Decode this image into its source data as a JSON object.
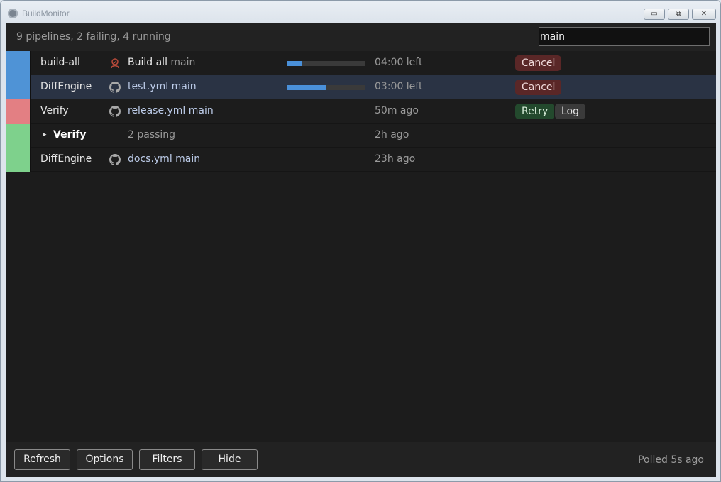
{
  "window": {
    "title": "BuildMonitor",
    "controls": {
      "minimize": "▭",
      "maximize": "⧉",
      "close": "✕"
    }
  },
  "summary": "9 pipelines, 2 failing, 4 running",
  "search": {
    "value": "main"
  },
  "colors": {
    "running": "#4f93d6",
    "failed": "#e37f83",
    "passed": "#7ed18c"
  },
  "rows": [
    {
      "status": "running",
      "name": "build-all",
      "icon": "person-icon",
      "workflow": "Build all",
      "branch": "main",
      "progress": 0.2,
      "time": "04:00 left",
      "actions": [
        "Cancel"
      ]
    },
    {
      "status": "running",
      "name": "DiffEngine",
      "icon": "github-icon",
      "workflow": "test.yml",
      "branch": "main",
      "progress": 0.5,
      "time": "03:00 left",
      "actions": [
        "Cancel"
      ],
      "selected": true
    },
    {
      "status": "failed",
      "name": "Verify",
      "icon": "github-icon",
      "workflow": "release.yml",
      "branch": "main",
      "time": "50m ago",
      "actions": [
        "Retry",
        "Log"
      ]
    },
    {
      "status": "passed",
      "name": "Verify",
      "group": true,
      "expander": "▸",
      "summary": "2 passing",
      "time": "2h ago"
    },
    {
      "status": "passed",
      "name": "DiffEngine",
      "icon": "github-icon",
      "workflow": "docs.yml",
      "branch": "main",
      "time": "23h ago"
    }
  ],
  "footer": {
    "buttons": [
      "Refresh",
      "Options",
      "Filters",
      "Hide"
    ],
    "polled": "Polled 5s ago"
  }
}
